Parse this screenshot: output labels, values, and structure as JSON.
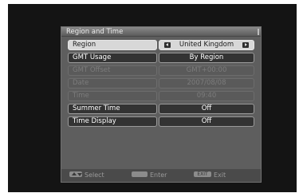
{
  "window": {
    "title": "Region and Time"
  },
  "rows": [
    {
      "label": "Region",
      "value": "United Kingdom"
    },
    {
      "label": "GMT Usage",
      "value": "By Region"
    },
    {
      "label": "GMT Offset",
      "value": "GMT+00:00"
    },
    {
      "label": "Date",
      "value": "2007/08/08"
    },
    {
      "label": "Time",
      "value": "09:40"
    },
    {
      "label": "Summer Time",
      "value": "Off"
    },
    {
      "label": "Time Display",
      "value": "Off"
    }
  ],
  "footer": {
    "select_label": "Select",
    "ok_key": "OK",
    "enter_label": "Enter",
    "exit_key": "EXIT",
    "exit_label": "Exit"
  },
  "icons": [
    "left-arrow-icon",
    "right-arrow-icon",
    "up-down-key-icon",
    "ok-key-icon",
    "exit-key-icon"
  ],
  "colors": {
    "selected_row": "#d8d8d8",
    "panel": "#5e5e5e",
    "screen": "#141414"
  }
}
